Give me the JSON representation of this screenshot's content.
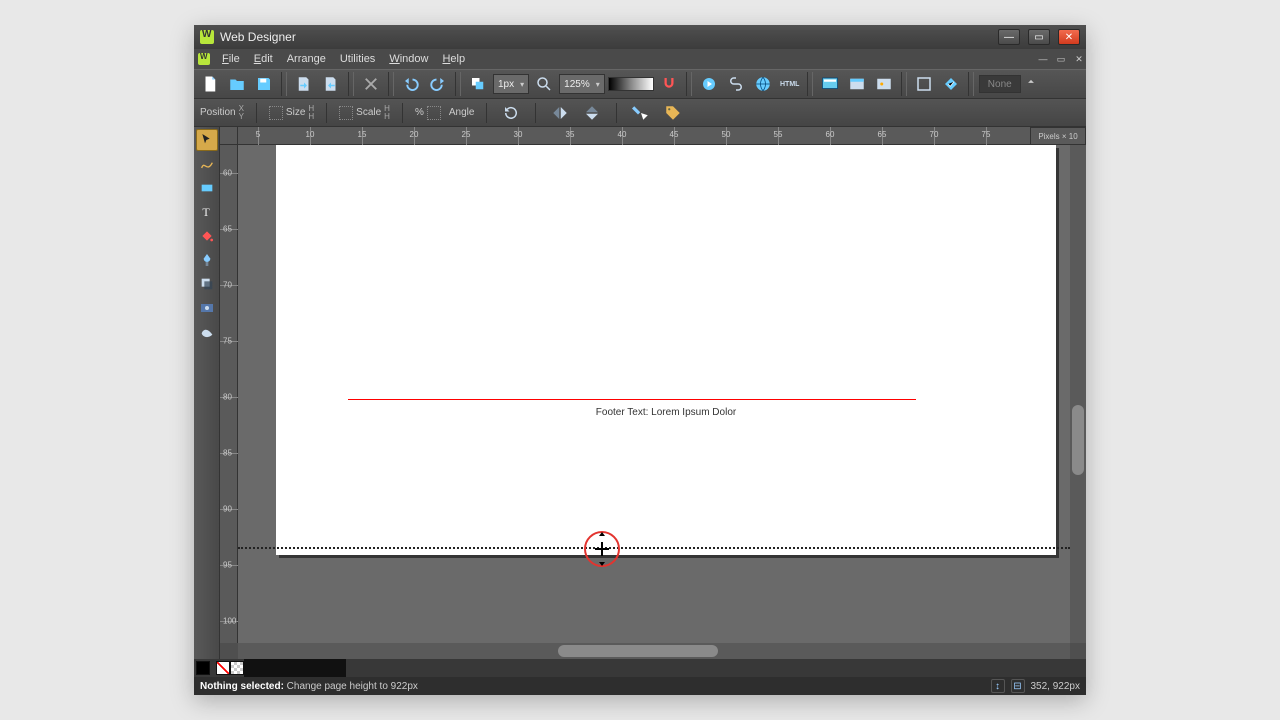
{
  "title": "Web Designer",
  "menu": {
    "file": "File",
    "edit": "Edit",
    "arrange": "Arrange",
    "utilities": "Utilities",
    "window": "Window",
    "help": "Help"
  },
  "toolbar": {
    "lineWidth": "1px",
    "zoom": "125%",
    "noneLabel": "None"
  },
  "propbar": {
    "position": "Position",
    "size": "Size",
    "scale": "Scale",
    "percent": "%",
    "angle": "Angle"
  },
  "units": "Pixels × 10",
  "rulerH": [
    "5",
    "10",
    "15",
    "20",
    "25",
    "30",
    "35",
    "40",
    "45",
    "50",
    "55",
    "60",
    "65",
    "70",
    "75"
  ],
  "rulerV": [
    "60",
    "65",
    "70",
    "75",
    "80",
    "85",
    "90",
    "95",
    "100"
  ],
  "canvas": {
    "footer": "Footer Text: Lorem Ipsum Dolor"
  },
  "colors": [
    "#000000",
    "#ffffff",
    "#1a1a1a",
    "#333333",
    "#4d4d4d",
    "#666666",
    "#808080",
    "#999999",
    "#b3b3b3",
    "#cccccc",
    "#e6e6e6",
    "#330000",
    "#660000",
    "#990000",
    "#cc0000",
    "#ff0000",
    "#663300",
    "#996600",
    "#cc9900",
    "#ffcc00",
    "#ffff00",
    "#ccff00",
    "#99ff00",
    "#66cc00",
    "#339900",
    "#006600",
    "#009933",
    "#00cc66",
    "#00ff99",
    "#00ffff",
    "#00ccff",
    "#0099ff",
    "#0066ff",
    "#0033cc",
    "#000099",
    "#330099",
    "#6600cc",
    "#9900ff",
    "#cc33ff",
    "#ff66ff",
    "#ff3399",
    "#cc0066",
    "#ff9999",
    "#ffcc99",
    "#ffff99",
    "#ccffcc",
    "#ccffff",
    "#ccccff",
    "#ffccff",
    "#805940",
    "#594028"
  ],
  "status": {
    "boldText": "Nothing selected:",
    "message": " Change page height to 922px",
    "coords": "352, 922px"
  }
}
